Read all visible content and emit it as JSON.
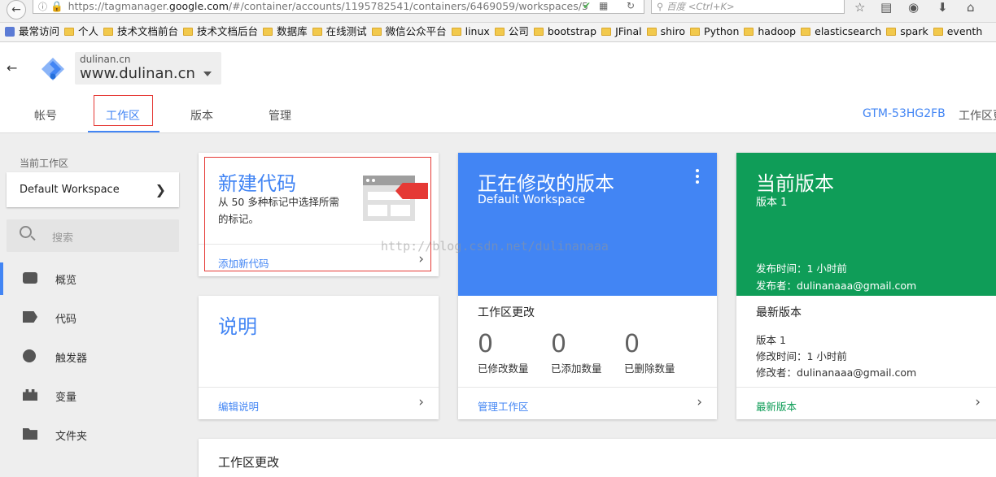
{
  "browser": {
    "url_prefix": "https://tagmanager.",
    "url_domain": "google.com",
    "url_rest": "/#/container/accounts/1195782541/containers/6469059/workspaces/5",
    "search_placeholder": "百度 <Ctrl+K>"
  },
  "bookmarks": [
    "最常访问",
    "个人",
    "技术文档前台",
    "技术文档后台",
    "数据库",
    "在线测试",
    "微信公众平台",
    "linux",
    "公司",
    "bootstrap",
    "JFinal",
    "shiro",
    "Python",
    "hadoop",
    "elasticsearch",
    "spark",
    "eventh"
  ],
  "header": {
    "account_name": "dulinan.cn",
    "container_name": "www.dulinan.cn",
    "tabs": [
      "帐号",
      "工作区",
      "版本",
      "管理"
    ],
    "active_tab": "工作区",
    "container_id": "GTM-53HG2FB",
    "right_text": "工作区更"
  },
  "sidebar": {
    "label": "当前工作区",
    "workspace": "Default Workspace",
    "search_placeholder": "搜索",
    "items": [
      {
        "label": "概览",
        "icon": "overview-icon"
      },
      {
        "label": "代码",
        "icon": "tag-icon"
      },
      {
        "label": "触发器",
        "icon": "trigger-icon"
      },
      {
        "label": "变量",
        "icon": "variable-icon"
      },
      {
        "label": "文件夹",
        "icon": "folder-icon"
      }
    ]
  },
  "cards": {
    "new_tag": {
      "title": "新建代码",
      "desc": "从 50 多种标记中选择所需的标记。",
      "link": "添加新代码"
    },
    "description": {
      "title": "说明",
      "link": "编辑说明"
    },
    "editing": {
      "title": "正在修改的版本",
      "subtitle": "Default Workspace",
      "section": "工作区更改",
      "stats": [
        {
          "value": "0",
          "label": "已修改数量"
        },
        {
          "value": "0",
          "label": "已添加数量"
        },
        {
          "value": "0",
          "label": "已删除数量"
        }
      ],
      "link": "管理工作区"
    },
    "current": {
      "title": "当前版本",
      "subtitle": "版本 1",
      "published": "发布时间：1 小时前",
      "publisher": "发布者：dulinanaaa@gmail.com",
      "section": "最新版本",
      "lines": [
        "版本 1",
        "修改时间：1 小时前",
        "修改者：dulinanaaa@gmail.com"
      ],
      "link": "最新版本"
    },
    "changes": {
      "title": "工作区更改"
    }
  },
  "watermark": "http://blog.csdn.net/dulinanaaa",
  "colors": {
    "blue": "#4285f4",
    "green": "#0f9d58",
    "red": "#e53935"
  }
}
